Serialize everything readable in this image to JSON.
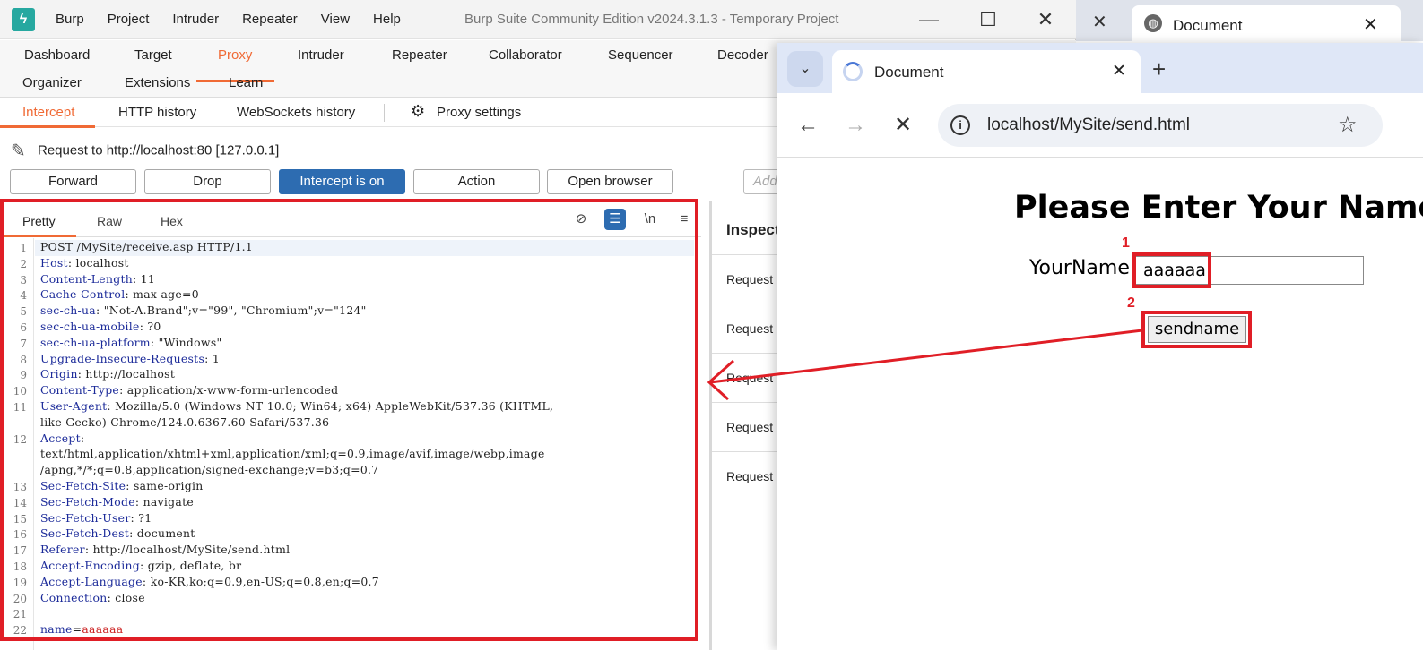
{
  "burp": {
    "menu": [
      "Burp",
      "Project",
      "Intruder",
      "Repeater",
      "View",
      "Help"
    ],
    "window_title": "Burp Suite Community Edition v2024.3.1.3 - Temporary Project",
    "controls": {
      "minimize": "—",
      "maximize": "☐",
      "close": "✕"
    },
    "main_tabs_row1": [
      "Dashboard",
      "Target",
      "Proxy",
      "Intruder",
      "Repeater",
      "Collaborator",
      "Sequencer",
      "Decoder"
    ],
    "main_tabs_row2": [
      "Organizer",
      "Extensions",
      "Learn"
    ],
    "active_main_tab": "Proxy",
    "proxy_tabs": [
      "Intercept",
      "HTTP history",
      "WebSockets history"
    ],
    "proxy_settings": "Proxy settings",
    "request_to": "Request to http://localhost:80  [127.0.0.1]",
    "buttons": {
      "forward": "Forward",
      "drop": "Drop",
      "intercept": "Intercept is on",
      "action": "Action",
      "open_browser": "Open browser"
    },
    "comment_placeholder": "Add",
    "editor_tabs": [
      "Pretty",
      "Raw",
      "Hex"
    ],
    "editor_tools": {
      "hide": "⊘",
      "wrap": "☰",
      "newline": "\\n",
      "menu": "≡"
    },
    "request_lines": [
      {
        "n": "1",
        "key": "",
        "val": "POST /MySite/receive.asp HTTP/1.1"
      },
      {
        "n": "2",
        "key": "Host",
        "val": ": localhost"
      },
      {
        "n": "3",
        "key": "Content-Length",
        "val": ": 11"
      },
      {
        "n": "4",
        "key": "Cache-Control",
        "val": ": max-age=0"
      },
      {
        "n": "5",
        "key": "sec-ch-ua",
        "val": ": \"Not-A.Brand\";v=\"99\", \"Chromium\";v=\"124\""
      },
      {
        "n": "6",
        "key": "sec-ch-ua-mobile",
        "val": ": ?0"
      },
      {
        "n": "7",
        "key": "sec-ch-ua-platform",
        "val": ": \"Windows\""
      },
      {
        "n": "8",
        "key": "Upgrade-Insecure-Requests",
        "val": ": 1"
      },
      {
        "n": "9",
        "key": "Origin",
        "val": ": http://localhost"
      },
      {
        "n": "10",
        "key": "Content-Type",
        "val": ": application/x-www-form-urlencoded"
      },
      {
        "n": "11",
        "key": "User-Agent",
        "val": ": Mozilla/5.0 (Windows NT 10.0; Win64; x64) AppleWebKit/537.36 (KHTML,"
      },
      {
        "n": "",
        "key": "",
        "val": "like Gecko) Chrome/124.0.6367.60 Safari/537.36"
      },
      {
        "n": "12",
        "key": "Accept",
        "val": ":"
      },
      {
        "n": "",
        "key": "",
        "val": "text/html,application/xhtml+xml,application/xml;q=0.9,image/avif,image/webp,image"
      },
      {
        "n": "",
        "key": "",
        "val": "/apng,*/*;q=0.8,application/signed-exchange;v=b3;q=0.7"
      },
      {
        "n": "13",
        "key": "Sec-Fetch-Site",
        "val": ": same-origin"
      },
      {
        "n": "14",
        "key": "Sec-Fetch-Mode",
        "val": ": navigate"
      },
      {
        "n": "15",
        "key": "Sec-Fetch-User",
        "val": ": ?1"
      },
      {
        "n": "16",
        "key": "Sec-Fetch-Dest",
        "val": ": document"
      },
      {
        "n": "17",
        "key": "Referer",
        "val": ": http://localhost/MySite/send.html"
      },
      {
        "n": "18",
        "key": "Accept-Encoding",
        "val": ": gzip, deflate, br"
      },
      {
        "n": "19",
        "key": "Accept-Language",
        "val": ": ko-KR,ko;q=0.9,en-US;q=0.8,en;q=0.7"
      },
      {
        "n": "20",
        "key": "Connection",
        "val": ": close"
      },
      {
        "n": "21",
        "key": "",
        "val": ""
      },
      {
        "n": "22",
        "key": "name",
        "val": "aaaaaa",
        "param": true
      }
    ],
    "inspector": {
      "title": "Inspector",
      "rows": [
        "Request attributes",
        "Request query parameters",
        "Request body parameters",
        "Request cookies",
        "Request headers"
      ]
    }
  },
  "background_browser": {
    "tab_title": "Document",
    "close": "✕"
  },
  "browser": {
    "tab_title": "Document",
    "tab_close": "✕",
    "new_tab": "+",
    "dropdown": "⌄",
    "nav": {
      "back": "←",
      "forward": "→",
      "stop": "✕"
    },
    "url": "localhost/MySite/send.html",
    "star": "☆",
    "page": {
      "heading": "Please Enter Your Name",
      "label": "YourName",
      "input_value": "aaaaaa",
      "button_label": "sendname"
    },
    "markers": [
      "1",
      "2"
    ]
  },
  "colors": {
    "burp_accent": "#f06a35",
    "intercept_blue": "#2d6cb1",
    "annotation_red": "#e01e26",
    "header_key": "#1b2a99"
  }
}
